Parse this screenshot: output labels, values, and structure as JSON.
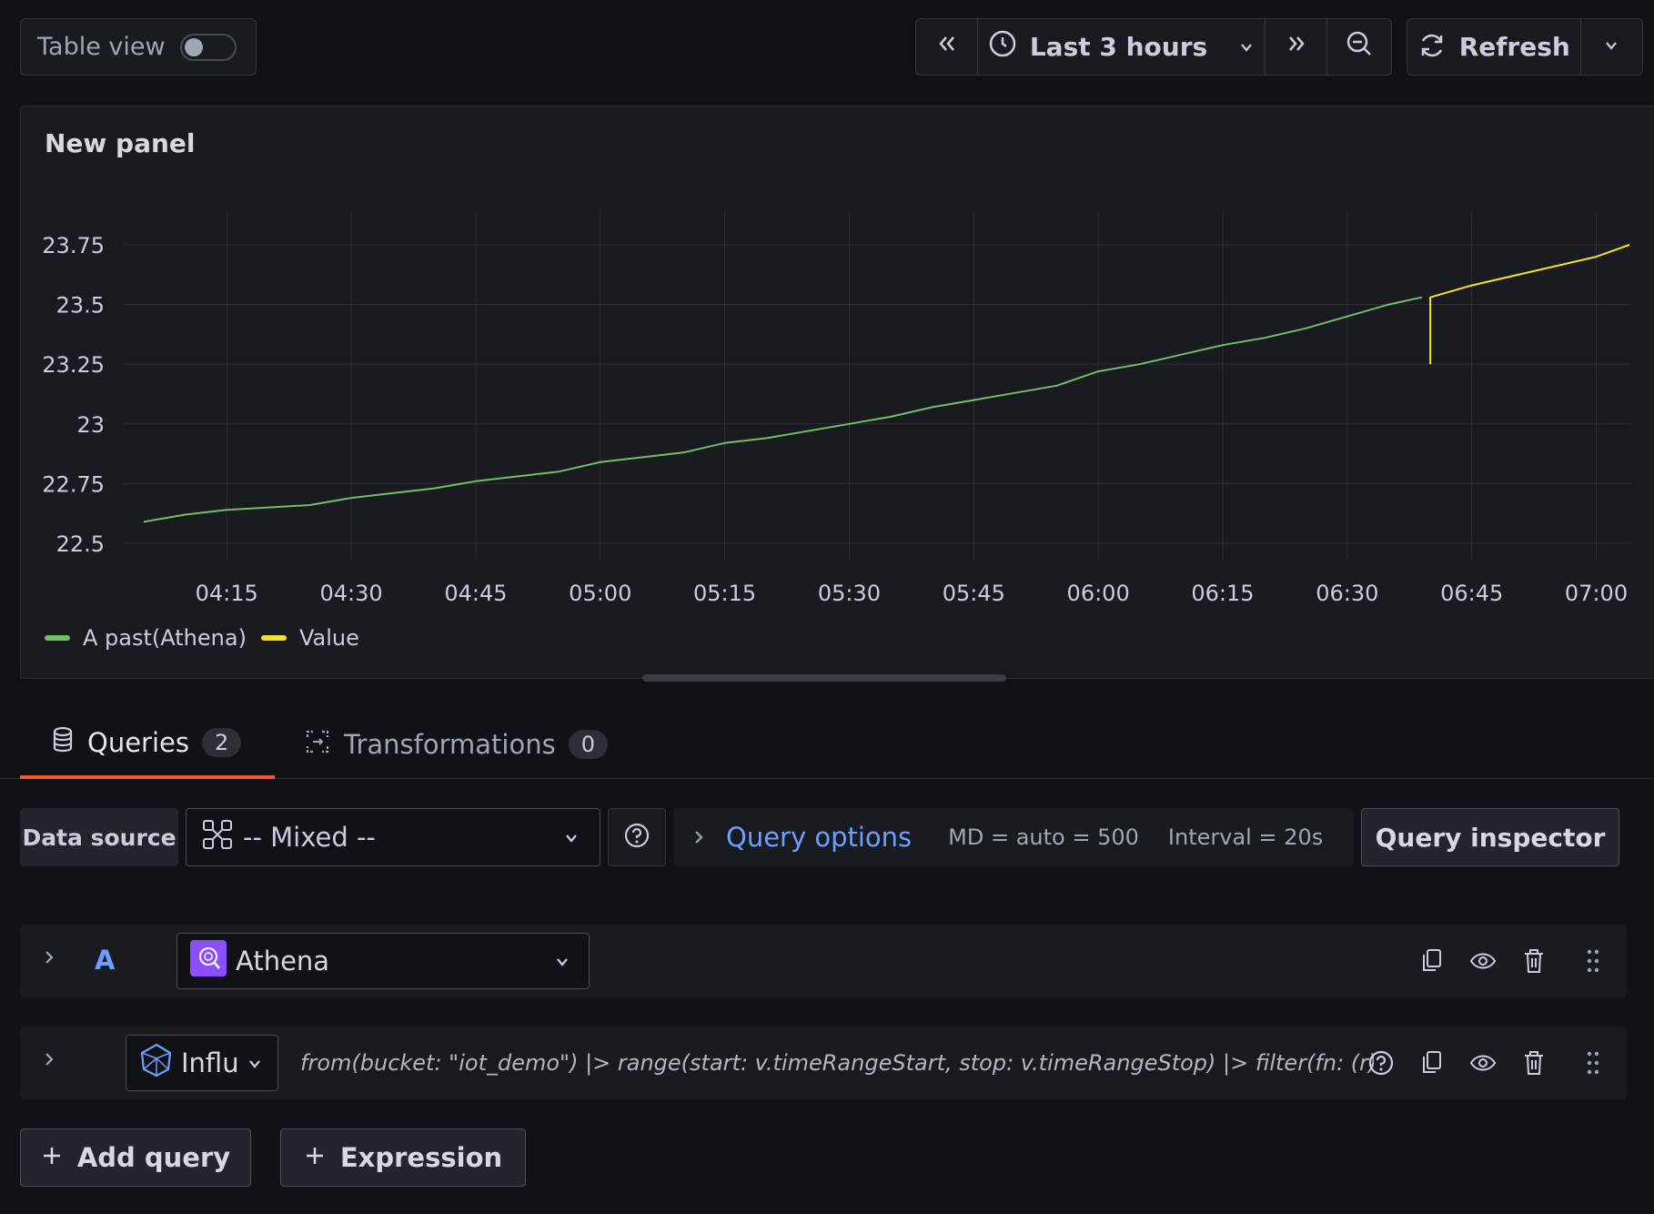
{
  "toolbar": {
    "table_view_label": "Table view",
    "time_range_label": "Last 3 hours",
    "refresh_label": "Refresh"
  },
  "panel": {
    "title": "New panel"
  },
  "chart_data": {
    "type": "line",
    "title": "New panel",
    "xlabel": "",
    "ylabel": "",
    "ylim": [
      22.5,
      23.75
    ],
    "x_ticks": [
      "04:15",
      "04:30",
      "04:45",
      "05:00",
      "05:15",
      "05:30",
      "05:45",
      "06:00",
      "06:15",
      "06:30",
      "06:45",
      "07:00"
    ],
    "y_ticks": [
      "23.75",
      "23.5",
      "23.25",
      "23",
      "22.75",
      "22.5"
    ],
    "grid": true,
    "legend_position": "bottom-left",
    "series": [
      {
        "name": "A past(Athena)",
        "color": "#73bf69",
        "points": [
          [
            "04:05",
            22.59
          ],
          [
            "04:10",
            22.62
          ],
          [
            "04:15",
            22.64
          ],
          [
            "04:20",
            22.65
          ],
          [
            "04:25",
            22.66
          ],
          [
            "04:30",
            22.69
          ],
          [
            "04:35",
            22.71
          ],
          [
            "04:40",
            22.73
          ],
          [
            "04:45",
            22.76
          ],
          [
            "04:50",
            22.78
          ],
          [
            "04:55",
            22.8
          ],
          [
            "05:00",
            22.84
          ],
          [
            "05:05",
            22.86
          ],
          [
            "05:10",
            22.88
          ],
          [
            "05:15",
            22.92
          ],
          [
            "05:20",
            22.94
          ],
          [
            "05:25",
            22.97
          ],
          [
            "05:30",
            23.0
          ],
          [
            "05:35",
            23.03
          ],
          [
            "05:40",
            23.07
          ],
          [
            "05:45",
            23.1
          ],
          [
            "05:50",
            23.13
          ],
          [
            "05:55",
            23.16
          ],
          [
            "06:00",
            23.22
          ],
          [
            "06:05",
            23.25
          ],
          [
            "06:10",
            23.29
          ],
          [
            "06:15",
            23.33
          ],
          [
            "06:20",
            23.36
          ],
          [
            "06:25",
            23.4
          ],
          [
            "06:30",
            23.45
          ],
          [
            "06:35",
            23.5
          ],
          [
            "06:39",
            23.53
          ]
        ]
      },
      {
        "name": "Value",
        "color": "#fade2a",
        "points": [
          [
            "06:40",
            23.25
          ],
          [
            "06:40",
            23.53
          ],
          [
            "06:45",
            23.58
          ],
          [
            "06:50",
            23.62
          ],
          [
            "06:55",
            23.66
          ],
          [
            "07:00",
            23.7
          ],
          [
            "07:04",
            23.75
          ]
        ]
      }
    ]
  },
  "tabs": [
    {
      "label": "Queries",
      "count": "2"
    },
    {
      "label": "Transformations",
      "count": "0"
    }
  ],
  "datasource": {
    "label": "Data source",
    "value": "-- Mixed --"
  },
  "query_options": {
    "label": "Query options",
    "md": "MD = auto = 500",
    "interval": "Interval = 20s"
  },
  "query_inspector_label": "Query inspector",
  "queries": [
    {
      "ref": "A",
      "datasource": "Athena"
    },
    {
      "ref": "",
      "datasource": "Influ",
      "text": "from(bucket: \"iot_demo\") |> range(start: v.timeRangeStart, stop: v.timeRangeStop) |> filter(fn: (r) ..."
    }
  ],
  "actions": {
    "add_query_label": "Add query",
    "expression_label": "Expression"
  },
  "colors": {
    "accent_blue": "#6e9fff",
    "tab_active": "#f05a28",
    "series_green": "#73bf69",
    "series_yellow": "#fade2a"
  }
}
